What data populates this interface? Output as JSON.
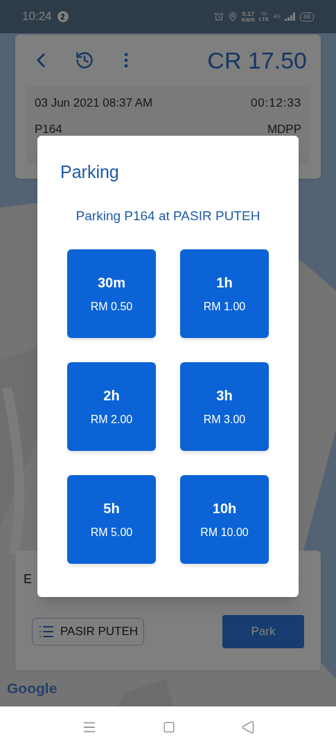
{
  "status_bar": {
    "time": "10:24",
    "notification_count": "2",
    "speed": "0.17",
    "speed_unit": "KB/S",
    "volte_top": "Vo",
    "volte_bottom": "LTE",
    "network": "4G",
    "battery": "88"
  },
  "header": {
    "balance": "CR 17.50"
  },
  "session": {
    "date": "03 Jun 2021 08:37 AM",
    "timer": "00:12:33",
    "plate": "P164",
    "council": "MDPP"
  },
  "bottom_card": {
    "label": "E",
    "zone": "PASIR PUTEH",
    "park_button": "Park"
  },
  "map": {
    "attribution": "Google"
  },
  "dialog": {
    "title": "Parking",
    "subtitle": "Parking P164 at PASIR PUTEH",
    "options": [
      {
        "duration": "30m",
        "price": "RM 0.50"
      },
      {
        "duration": "1h",
        "price": "RM 1.00"
      },
      {
        "duration": "2h",
        "price": "RM 2.00"
      },
      {
        "duration": "3h",
        "price": "RM 3.00"
      },
      {
        "duration": "5h",
        "price": "RM 5.00"
      },
      {
        "duration": "10h",
        "price": "RM 10.00"
      }
    ]
  }
}
